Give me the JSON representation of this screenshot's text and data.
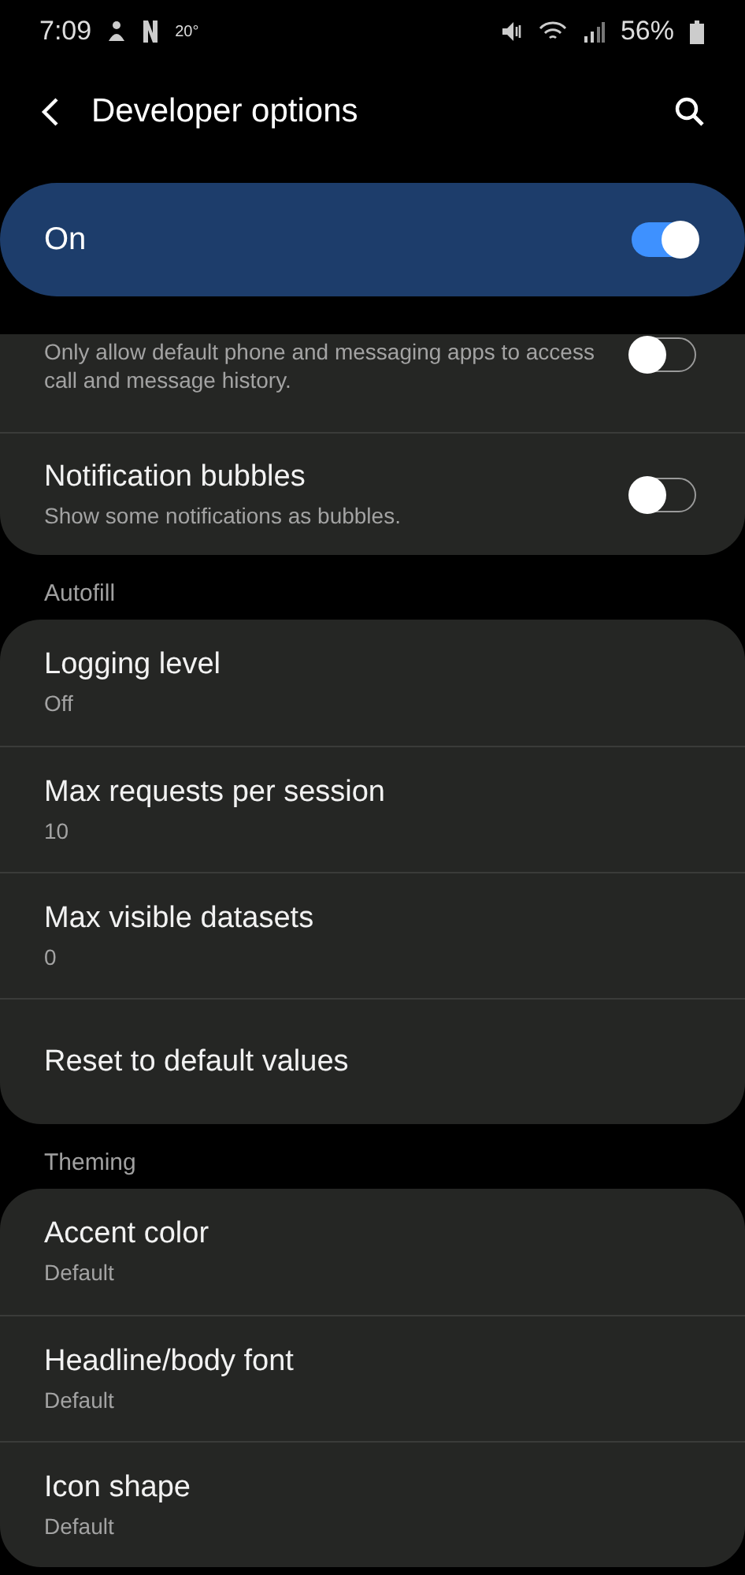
{
  "status_bar": {
    "time": "7:09",
    "temperature": "20°",
    "battery": "56%"
  },
  "header": {
    "title": "Developer options"
  },
  "master_switch": {
    "label": "On",
    "on": true
  },
  "top_card": [
    {
      "subtitle": "Only allow default phone and messaging apps to access call and message history.",
      "on": false
    },
    {
      "title": "Notification bubbles",
      "subtitle": "Show some notifications as bubbles.",
      "on": false
    }
  ],
  "sections": [
    {
      "heading": "Autofill",
      "items": [
        {
          "title": "Logging level",
          "subtitle": "Off"
        },
        {
          "title": "Max requests per session",
          "subtitle": "10"
        },
        {
          "title": "Max visible datasets",
          "subtitle": "0"
        },
        {
          "title": "Reset to default values"
        }
      ]
    },
    {
      "heading": "Theming",
      "items": [
        {
          "title": "Accent color",
          "subtitle": "Default"
        },
        {
          "title": "Headline/body font",
          "subtitle": "Default"
        },
        {
          "title": "Icon shape",
          "subtitle": "Default"
        }
      ]
    }
  ]
}
